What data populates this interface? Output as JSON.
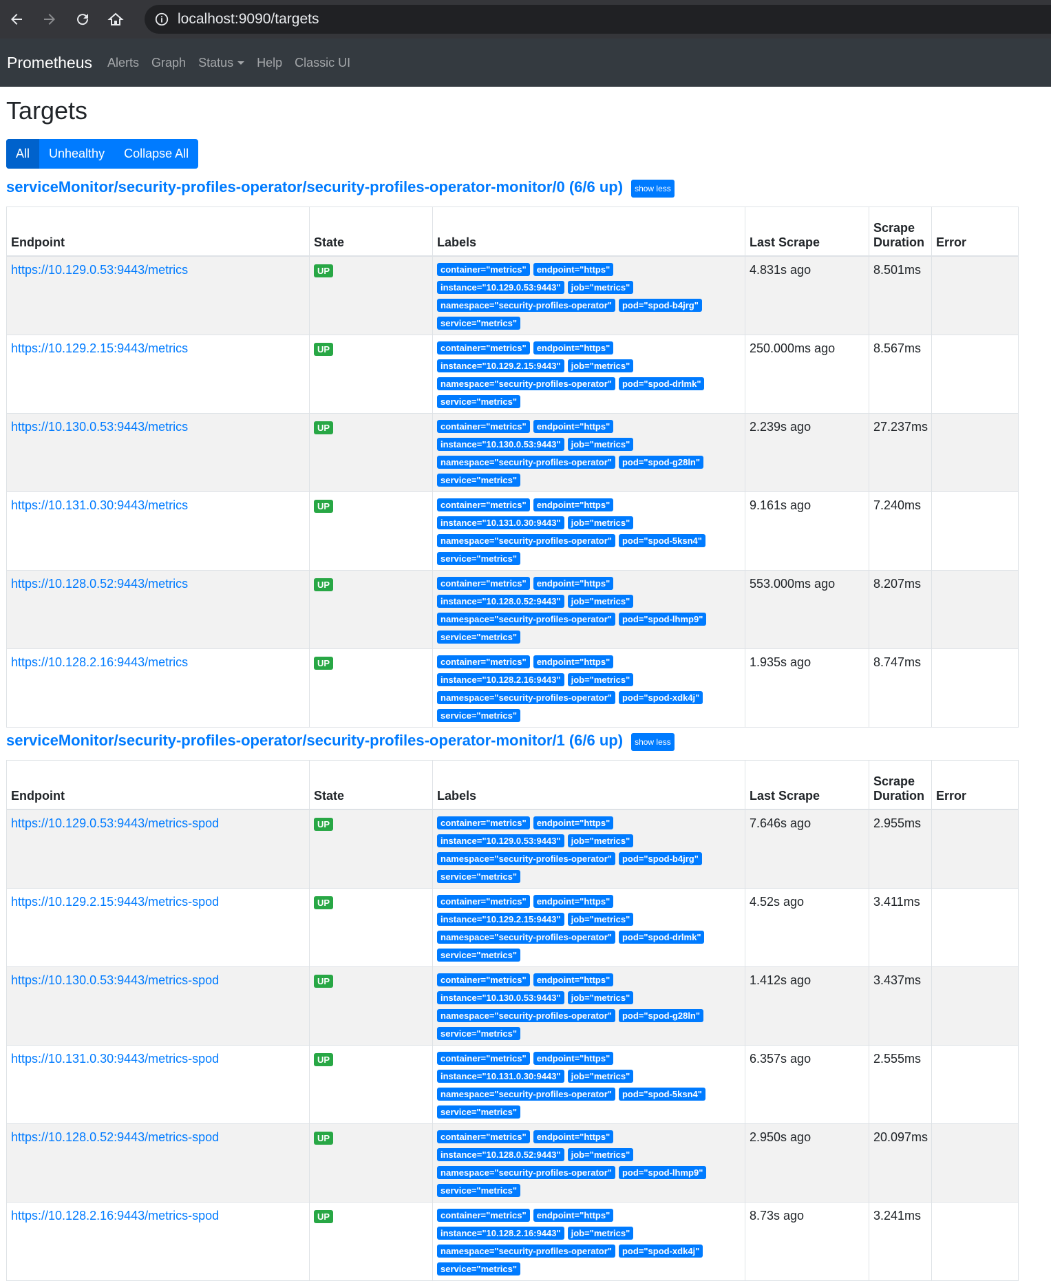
{
  "browser": {
    "url": "localhost:9090/targets"
  },
  "nav": {
    "brand": "Prometheus",
    "alerts": "Alerts",
    "graph": "Graph",
    "status": "Status",
    "help": "Help",
    "classic": "Classic UI"
  },
  "page": {
    "title": "Targets",
    "btn_all": "All",
    "btn_unhealthy": "Unhealthy",
    "btn_collapse": "Collapse All"
  },
  "columns": {
    "endpoint": "Endpoint",
    "state": "State",
    "labels": "Labels",
    "last_scrape": "Last Scrape",
    "scrape_duration_1": "Scrape",
    "scrape_duration_2": "Duration",
    "error": "Error"
  },
  "pools": [
    {
      "title": "serviceMonitor/security-profiles-operator/security-profiles-operator-monitor/0 (6/6 up)",
      "toggle": "show less",
      "rows": [
        {
          "endpoint": "https://10.129.0.53:9443/metrics",
          "state": "UP",
          "labels": [
            "container=\"metrics\"",
            "endpoint=\"https\"",
            "instance=\"10.129.0.53:9443\"",
            "job=\"metrics\"",
            "namespace=\"security-profiles-operator\"",
            "pod=\"spod-b4jrg\"",
            "service=\"metrics\""
          ],
          "last": "4.831s ago",
          "duration": "8.501ms",
          "error": ""
        },
        {
          "endpoint": "https://10.129.2.15:9443/metrics",
          "state": "UP",
          "labels": [
            "container=\"metrics\"",
            "endpoint=\"https\"",
            "instance=\"10.129.2.15:9443\"",
            "job=\"metrics\"",
            "namespace=\"security-profiles-operator\"",
            "pod=\"spod-drlmk\"",
            "service=\"metrics\""
          ],
          "last": "250.000ms ago",
          "duration": "8.567ms",
          "error": ""
        },
        {
          "endpoint": "https://10.130.0.53:9443/metrics",
          "state": "UP",
          "labels": [
            "container=\"metrics\"",
            "endpoint=\"https\"",
            "instance=\"10.130.0.53:9443\"",
            "job=\"metrics\"",
            "namespace=\"security-profiles-operator\"",
            "pod=\"spod-g28ln\"",
            "service=\"metrics\""
          ],
          "last": "2.239s ago",
          "duration": "27.237ms",
          "error": ""
        },
        {
          "endpoint": "https://10.131.0.30:9443/metrics",
          "state": "UP",
          "labels": [
            "container=\"metrics\"",
            "endpoint=\"https\"",
            "instance=\"10.131.0.30:9443\"",
            "job=\"metrics\"",
            "namespace=\"security-profiles-operator\"",
            "pod=\"spod-5ksn4\"",
            "service=\"metrics\""
          ],
          "last": "9.161s ago",
          "duration": "7.240ms",
          "error": ""
        },
        {
          "endpoint": "https://10.128.0.52:9443/metrics",
          "state": "UP",
          "labels": [
            "container=\"metrics\"",
            "endpoint=\"https\"",
            "instance=\"10.128.0.52:9443\"",
            "job=\"metrics\"",
            "namespace=\"security-profiles-operator\"",
            "pod=\"spod-lhmp9\"",
            "service=\"metrics\""
          ],
          "last": "553.000ms ago",
          "duration": "8.207ms",
          "error": ""
        },
        {
          "endpoint": "https://10.128.2.16:9443/metrics",
          "state": "UP",
          "labels": [
            "container=\"metrics\"",
            "endpoint=\"https\"",
            "instance=\"10.128.2.16:9443\"",
            "job=\"metrics\"",
            "namespace=\"security-profiles-operator\"",
            "pod=\"spod-xdk4j\"",
            "service=\"metrics\""
          ],
          "last": "1.935s ago",
          "duration": "8.747ms",
          "error": ""
        }
      ]
    },
    {
      "title": "serviceMonitor/security-profiles-operator/security-profiles-operator-monitor/1 (6/6 up)",
      "toggle": "show less",
      "rows": [
        {
          "endpoint": "https://10.129.0.53:9443/metrics-spod",
          "state": "UP",
          "labels": [
            "container=\"metrics\"",
            "endpoint=\"https\"",
            "instance=\"10.129.0.53:9443\"",
            "job=\"metrics\"",
            "namespace=\"security-profiles-operator\"",
            "pod=\"spod-b4jrg\"",
            "service=\"metrics\""
          ],
          "last": "7.646s ago",
          "duration": "2.955ms",
          "error": ""
        },
        {
          "endpoint": "https://10.129.2.15:9443/metrics-spod",
          "state": "UP",
          "labels": [
            "container=\"metrics\"",
            "endpoint=\"https\"",
            "instance=\"10.129.2.15:9443\"",
            "job=\"metrics\"",
            "namespace=\"security-profiles-operator\"",
            "pod=\"spod-drlmk\"",
            "service=\"metrics\""
          ],
          "last": "4.52s ago",
          "duration": "3.411ms",
          "error": ""
        },
        {
          "endpoint": "https://10.130.0.53:9443/metrics-spod",
          "state": "UP",
          "labels": [
            "container=\"metrics\"",
            "endpoint=\"https\"",
            "instance=\"10.130.0.53:9443\"",
            "job=\"metrics\"",
            "namespace=\"security-profiles-operator\"",
            "pod=\"spod-g28ln\"",
            "service=\"metrics\""
          ],
          "last": "1.412s ago",
          "duration": "3.437ms",
          "error": ""
        },
        {
          "endpoint": "https://10.131.0.30:9443/metrics-spod",
          "state": "UP",
          "labels": [
            "container=\"metrics\"",
            "endpoint=\"https\"",
            "instance=\"10.131.0.30:9443\"",
            "job=\"metrics\"",
            "namespace=\"security-profiles-operator\"",
            "pod=\"spod-5ksn4\"",
            "service=\"metrics\""
          ],
          "last": "6.357s ago",
          "duration": "2.555ms",
          "error": ""
        },
        {
          "endpoint": "https://10.128.0.52:9443/metrics-spod",
          "state": "UP",
          "labels": [
            "container=\"metrics\"",
            "endpoint=\"https\"",
            "instance=\"10.128.0.52:9443\"",
            "job=\"metrics\"",
            "namespace=\"security-profiles-operator\"",
            "pod=\"spod-lhmp9\"",
            "service=\"metrics\""
          ],
          "last": "2.950s ago",
          "duration": "20.097ms",
          "error": ""
        },
        {
          "endpoint": "https://10.128.2.16:9443/metrics-spod",
          "state": "UP",
          "labels": [
            "container=\"metrics\"",
            "endpoint=\"https\"",
            "instance=\"10.128.2.16:9443\"",
            "job=\"metrics\"",
            "namespace=\"security-profiles-operator\"",
            "pod=\"spod-xdk4j\"",
            "service=\"metrics\""
          ],
          "last": "8.73s ago",
          "duration": "3.241ms",
          "error": ""
        }
      ]
    }
  ]
}
